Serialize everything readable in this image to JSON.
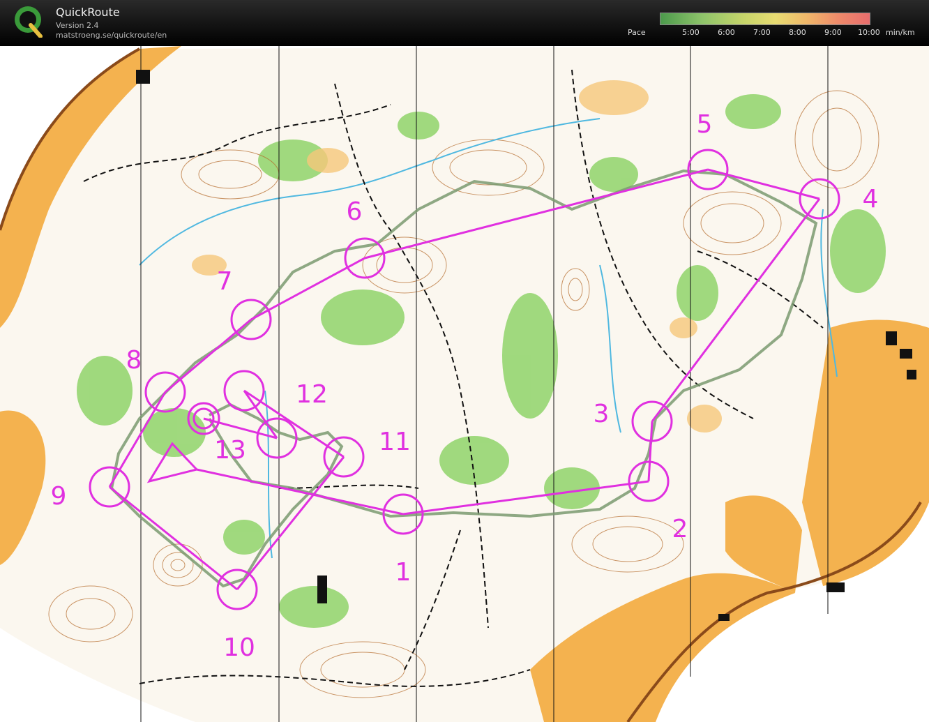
{
  "app": {
    "title": "QuickRoute",
    "version": "Version 2.4",
    "url": "matstroeng.se/quickroute/en",
    "logo_letter": "Q"
  },
  "pace_legend": {
    "label": "Pace",
    "ticks": [
      "5:00",
      "6:00",
      "7:00",
      "8:00",
      "9:00",
      "10:00"
    ],
    "unit": "min/km"
  },
  "map": {
    "course_color": "#e030e0",
    "route_color": "#7a9a70",
    "controls": [
      {
        "label": "1"
      },
      {
        "label": "2"
      },
      {
        "label": "3"
      },
      {
        "label": "4"
      },
      {
        "label": "5"
      },
      {
        "label": "6"
      },
      {
        "label": "7"
      },
      {
        "label": "8"
      },
      {
        "label": "9"
      },
      {
        "label": "10"
      },
      {
        "label": "11"
      },
      {
        "label": "12"
      },
      {
        "label": "13"
      }
    ]
  }
}
